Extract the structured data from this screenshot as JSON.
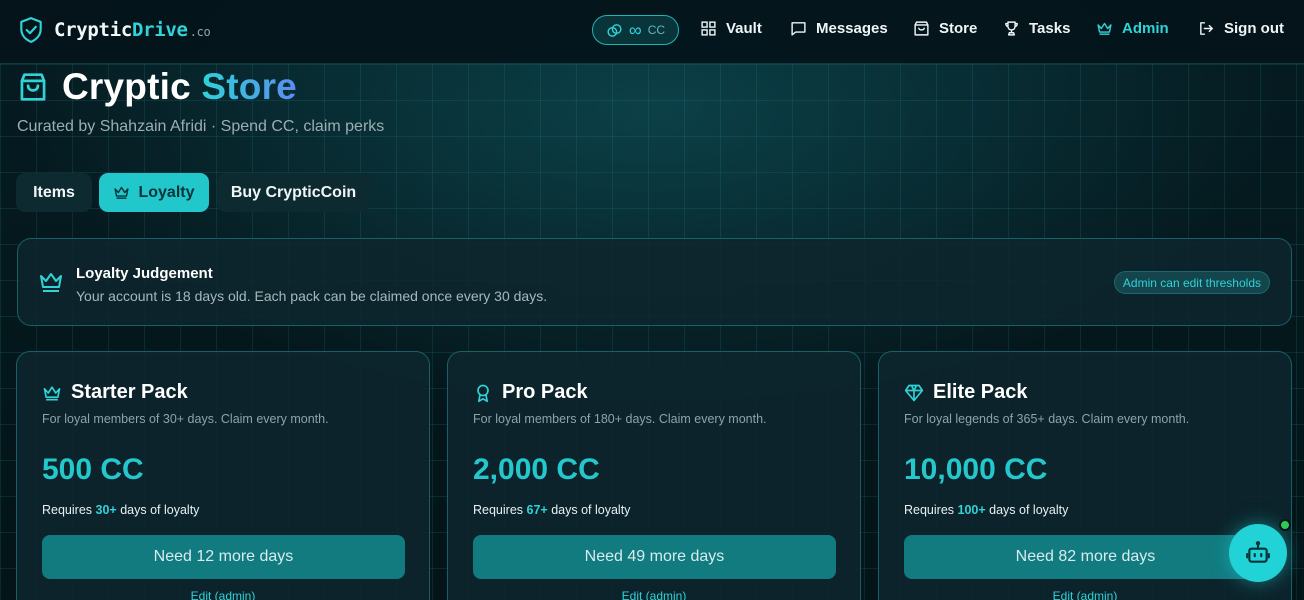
{
  "brand": {
    "name_main": "Cryptic",
    "name_accent": "Drive",
    "tld": ".co"
  },
  "nav": {
    "balance_symbol": "∞",
    "balance_unit": "CC",
    "items": [
      {
        "label": "Vault",
        "icon": "grid-icon"
      },
      {
        "label": "Messages",
        "icon": "message-square-icon"
      },
      {
        "label": "Store",
        "icon": "shopping-bag-icon"
      },
      {
        "label": "Tasks",
        "icon": "trophy-icon"
      },
      {
        "label": "Admin",
        "icon": "crown-icon"
      },
      {
        "label": "Sign out",
        "icon": "log-out-icon"
      }
    ]
  },
  "header": {
    "title_main": "Cryptic",
    "title_accent": "Store",
    "subtitle": "Curated by Shahzain Afridi · Spend CC, claim perks"
  },
  "tabs": [
    {
      "label": "Items",
      "active": false
    },
    {
      "label": "Loyalty",
      "active": true
    },
    {
      "label": "Buy CrypticCoin",
      "active": false
    }
  ],
  "judgement": {
    "title": "Loyalty Judgement",
    "description": "Your account is 18 days old. Each pack can be claimed once every 30 days.",
    "admin_badge": "Admin can edit thresholds"
  },
  "packs": [
    {
      "title": "Starter Pack",
      "icon": "crown-icon",
      "description": "For loyal members of 30+ days. Claim every month.",
      "price": "500 CC",
      "req_prefix": "Requires",
      "req_days": "30+",
      "req_suffix": "days of loyalty",
      "button": "Need 12 more days",
      "edit": "Edit (admin)"
    },
    {
      "title": "Pro Pack",
      "icon": "award-icon",
      "description": "For loyal members of 180+ days. Claim every month.",
      "price": "2,000 CC",
      "req_prefix": "Requires",
      "req_days": "67+",
      "req_suffix": "days of loyalty",
      "button": "Need 49 more days",
      "edit": "Edit (admin)"
    },
    {
      "title": "Elite Pack",
      "icon": "diamond-icon",
      "description": "For loyal legends of 365+ days. Claim every month.",
      "price": "10,000 CC",
      "req_prefix": "Requires",
      "req_days": "100+",
      "req_suffix": "days of loyalty",
      "button": "Need 82 more days",
      "edit": "Edit (admin)"
    }
  ],
  "colors": {
    "accent": "#2fd3d8",
    "background": "#04161c",
    "card": "#0e262e",
    "online": "#2ecc52"
  }
}
